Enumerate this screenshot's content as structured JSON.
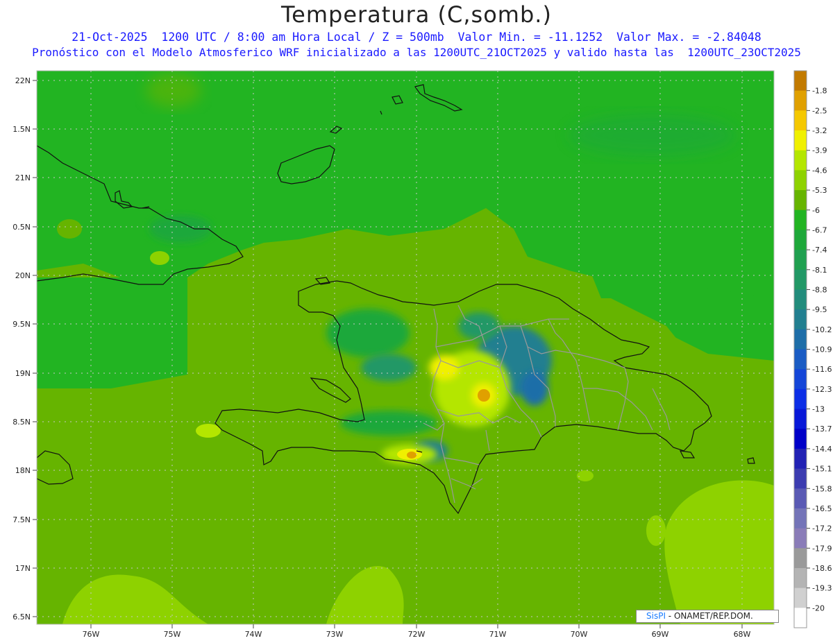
{
  "header": {
    "title": "Temperatura (C,somb.)",
    "subtitle_line1": "21-Oct-2025  1200 UTC / 8:00 am Hora Local / Z = 500mb  Valor Min. = -11.1252  Valor Max. = -2.84048",
    "subtitle_line2": "Pronóstico con el Modelo Atmosferico WRF inicializado a las 1200UTC_21OCT2025 y valido hasta las  1200UTC_23OCT2025"
  },
  "axes": {
    "lat_labels": [
      "22N",
      "1.5N",
      "21N",
      "0.5N",
      "20N",
      "9.5N",
      "19N",
      "8.5N",
      "18N",
      "7.5N",
      "17N",
      "6.5N"
    ],
    "lon_labels": [
      "76W",
      "75W",
      "74W",
      "73W",
      "72W",
      "71W",
      "70W",
      "69W",
      "68W"
    ]
  },
  "colorbar": {
    "labels": [
      "-1.8",
      "-2.5",
      "-3.2",
      "-3.9",
      "-4.6",
      "-5.3",
      "-6",
      "-6.7",
      "-7.4",
      "-8.1",
      "-8.8",
      "-9.5",
      "-10.2",
      "-10.9",
      "-11.6",
      "-12.3",
      "-13",
      "-13.7",
      "-14.4",
      "-15.1",
      "-15.8",
      "-16.5",
      "-17.2",
      "-17.9",
      "-18.6",
      "-19.3",
      "-20"
    ],
    "colors": [
      "#c27a00",
      "#e0a000",
      "#f5c800",
      "#f0f000",
      "#b4e600",
      "#8ed200",
      "#66b400",
      "#22b422",
      "#1ea83a",
      "#20a050",
      "#229866",
      "#228c7c",
      "#227f90",
      "#1e6ea8",
      "#1a5cc4",
      "#1446d8",
      "#0c2ee6",
      "#0818d8",
      "#0000c8",
      "#2222b4",
      "#3c3cb0",
      "#5a5ab4",
      "#7474b8",
      "#8a7cb8",
      "#9a9a9a",
      "#b4b4b4",
      "#d0d0d0",
      "#ffffff"
    ]
  },
  "credit": {
    "brand": "SisPI",
    "text": " - ONAMET/REP.DOM."
  }
}
